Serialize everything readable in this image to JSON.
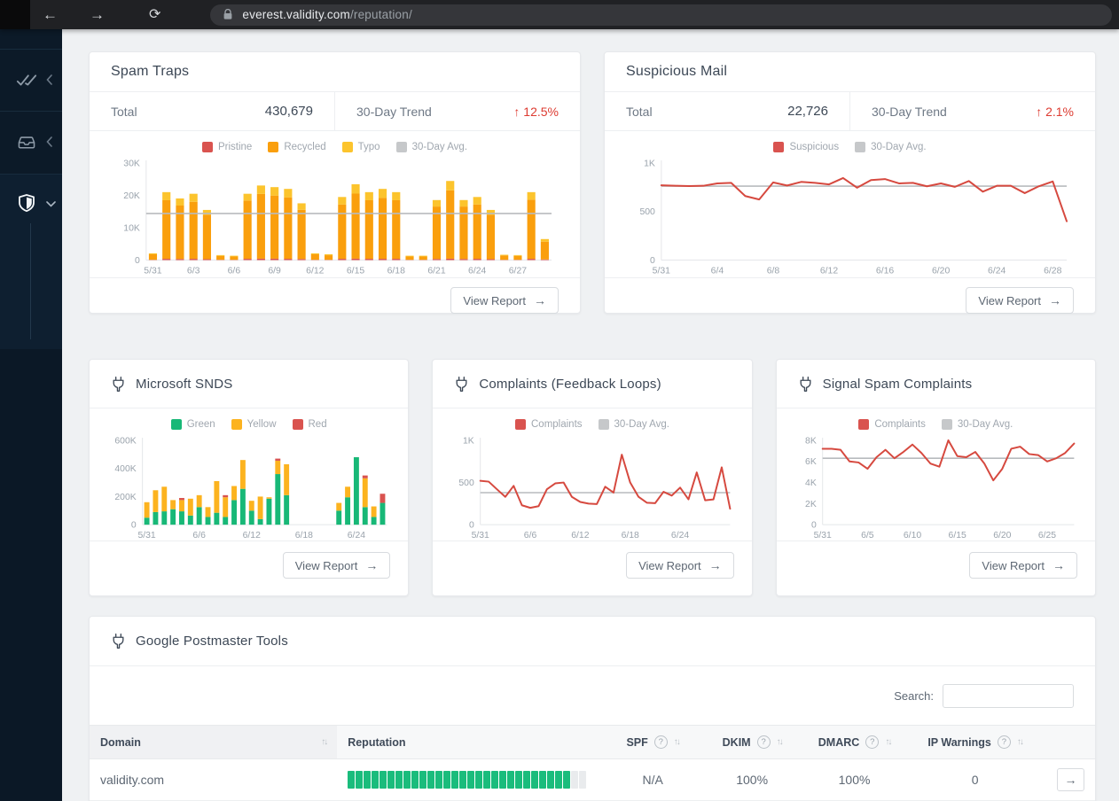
{
  "browser": {
    "url_host": "everest.validity.com",
    "url_path": "/reputation/"
  },
  "cards": {
    "spam_traps": {
      "title": "Spam Traps",
      "total_label": "Total",
      "total_value": "430,679",
      "trend_label": "30-Day Trend",
      "trend_arrow": "↑",
      "trend_value": "12.5%",
      "view_report": "View Report",
      "view_report_arrow": "→"
    },
    "suspicious_mail": {
      "title": "Suspicious Mail",
      "total_label": "Total",
      "total_value": "22,726",
      "trend_label": "30-Day Trend",
      "trend_arrow": "↑",
      "trend_value": "2.1%",
      "view_report": "View Report",
      "view_report_arrow": "→"
    },
    "msft_snds": {
      "title": "Microsoft SNDS",
      "view_report": "View Report",
      "view_report_arrow": "→"
    },
    "complaints_fbl": {
      "title": "Complaints (Feedback Loops)",
      "view_report": "View Report",
      "view_report_arrow": "→"
    },
    "signal_spam": {
      "title": "Signal Spam Complaints",
      "view_report": "View Report",
      "view_report_arrow": "→"
    },
    "google_postmaster": {
      "title": "Google Postmaster Tools",
      "search_label": "Search:",
      "search_value": "",
      "columns": [
        "Domain",
        "Reputation",
        "SPF",
        "DKIM",
        "DMARC",
        "IP Warnings"
      ],
      "rows": [
        {
          "domain": "validity.com",
          "reputation_segments": 30,
          "reputation_filled": 28,
          "spf": "N/A",
          "dkim": "100%",
          "dmarc": "100%",
          "ip_warnings": "0",
          "row_arrow": "→"
        }
      ]
    }
  },
  "colors": {
    "red": "#d9534f",
    "line_red": "#d6493f",
    "orange": "#fa9f0d",
    "yellow": "#fcc42d",
    "green": "#18b877",
    "avg_gray": "#b8bbbe",
    "trend_red": "#dd3b31",
    "table_green": "#1abc7c"
  },
  "chart_data": [
    {
      "id": "spam_traps",
      "type": "bar",
      "title": "Spam Traps",
      "categories": [
        "5/31",
        "6/1",
        "6/2",
        "6/3",
        "6/4",
        "6/5",
        "6/6",
        "6/7",
        "6/8",
        "6/9",
        "6/10",
        "6/11",
        "6/12",
        "6/13",
        "6/14",
        "6/15",
        "6/16",
        "6/17",
        "6/18",
        "6/19",
        "6/20",
        "6/21",
        "6/22",
        "6/23",
        "6/24",
        "6/25",
        "6/26",
        "6/27",
        "6/28",
        "6/29"
      ],
      "series": [
        {
          "name": "Pristine",
          "color": "#d9534f",
          "values": [
            100,
            400,
            350,
            400,
            300,
            100,
            100,
            400,
            450,
            450,
            400,
            350,
            100,
            100,
            400,
            450,
            400,
            400,
            400,
            100,
            100,
            350,
            450,
            350,
            400,
            300,
            100,
            100,
            400,
            200
          ]
        },
        {
          "name": "Recycled",
          "color": "#fa9f0d",
          "values": [
            1700,
            18100,
            16500,
            17600,
            13700,
            1200,
            1000,
            18000,
            20000,
            19500,
            19000,
            15200,
            1700,
            1400,
            16800,
            20100,
            18100,
            18800,
            18100,
            1000,
            1000,
            16200,
            21100,
            16200,
            16800,
            13700,
            1300,
            1200,
            18300,
            5500
          ]
        },
        {
          "name": "Typo",
          "color": "#fcc42d",
          "values": [
            300,
            2500,
            2200,
            2500,
            1500,
            250,
            250,
            2100,
            2600,
            2600,
            2600,
            2000,
            300,
            300,
            2300,
            2900,
            2500,
            2800,
            2500,
            250,
            250,
            2000,
            2900,
            2000,
            2300,
            1500,
            250,
            250,
            2300,
            800
          ]
        }
      ],
      "avg": {
        "label": "30-Day Avg.",
        "value": 14400,
        "color": "#b8bbbe"
      },
      "legend": [
        {
          "label": "Pristine",
          "color": "#d9534f"
        },
        {
          "label": "Recycled",
          "color": "#fa9f0d"
        },
        {
          "label": "Typo",
          "color": "#fcc42d"
        },
        {
          "label": "30-Day Avg.",
          "color": "#c6c8ca"
        }
      ],
      "ymax": 30000,
      "yticks": [
        {
          "v": 0,
          "label": "0"
        },
        {
          "v": 10000,
          "label": "10K"
        },
        {
          "v": 20000,
          "label": "20K"
        },
        {
          "v": 30000,
          "label": "30K"
        }
      ],
      "xticks": [
        {
          "i": 0,
          "label": "5/31"
        },
        {
          "i": 3,
          "label": "6/3"
        },
        {
          "i": 6,
          "label": "6/6"
        },
        {
          "i": 9,
          "label": "6/9"
        },
        {
          "i": 12,
          "label": "6/12"
        },
        {
          "i": 15,
          "label": "6/15"
        },
        {
          "i": 18,
          "label": "6/18"
        },
        {
          "i": 21,
          "label": "6/21"
        },
        {
          "i": 24,
          "label": "6/24"
        },
        {
          "i": 27,
          "label": "6/27"
        }
      ]
    },
    {
      "id": "suspicious_mail",
      "type": "line",
      "title": "Suspicious Mail",
      "categories": [
        "5/31",
        "6/1",
        "6/2",
        "6/3",
        "6/4",
        "6/5",
        "6/6",
        "6/7",
        "6/8",
        "6/9",
        "6/10",
        "6/11",
        "6/12",
        "6/13",
        "6/14",
        "6/15",
        "6/16",
        "6/17",
        "6/18",
        "6/19",
        "6/20",
        "6/21",
        "6/22",
        "6/23",
        "6/24",
        "6/25",
        "6/26",
        "6/27",
        "6/28",
        "6/29"
      ],
      "series": [
        {
          "name": "Suspicious",
          "color": "#d6493f",
          "values": [
            770,
            765,
            763,
            765,
            790,
            795,
            660,
            625,
            800,
            768,
            805,
            795,
            780,
            845,
            745,
            825,
            835,
            790,
            795,
            760,
            790,
            755,
            815,
            705,
            765,
            765,
            690,
            760,
            810,
            400
          ]
        }
      ],
      "avg": {
        "label": "30-Day Avg.",
        "value": 762,
        "color": "#b8bbbe"
      },
      "legend": [
        {
          "label": "Suspicious",
          "color": "#d9534f"
        },
        {
          "label": "30-Day Avg.",
          "color": "#c6c8ca"
        }
      ],
      "ymax": 1000,
      "yticks": [
        {
          "v": 0,
          "label": "0"
        },
        {
          "v": 500,
          "label": "500"
        },
        {
          "v": 1000,
          "label": "1K"
        }
      ],
      "xticks": [
        {
          "i": 0,
          "label": "5/31"
        },
        {
          "i": 4,
          "label": "6/4"
        },
        {
          "i": 8,
          "label": "6/8"
        },
        {
          "i": 12,
          "label": "6/12"
        },
        {
          "i": 16,
          "label": "6/16"
        },
        {
          "i": 20,
          "label": "6/20"
        },
        {
          "i": 24,
          "label": "6/24"
        },
        {
          "i": 28,
          "label": "6/28"
        }
      ]
    },
    {
      "id": "msft_snds",
      "type": "bar",
      "title": "Microsoft SNDS",
      "categories": [
        "5/31",
        "6/1",
        "6/2",
        "6/3",
        "6/4",
        "6/5",
        "6/6",
        "6/7",
        "6/8",
        "6/9",
        "6/10",
        "6/11",
        "6/12",
        "6/13",
        "6/14",
        "6/15",
        "6/16",
        "6/17",
        "6/18",
        "6/19",
        "6/20",
        "6/21",
        "6/22",
        "6/23",
        "6/24",
        "6/25",
        "6/26",
        "6/27"
      ],
      "unit": "K",
      "series": [
        {
          "name": "Green",
          "color": "#18b877",
          "values": [
            50,
            90,
            95,
            110,
            95,
            65,
            125,
            55,
            85,
            55,
            175,
            255,
            100,
            40,
            185,
            360,
            210,
            0,
            0,
            0,
            0,
            0,
            100,
            195,
            480,
            125,
            55,
            155
          ]
        },
        {
          "name": "Yellow",
          "color": "#fcb31f",
          "values": [
            110,
            155,
            175,
            65,
            80,
            120,
            85,
            70,
            225,
            140,
            100,
            205,
            70,
            160,
            10,
            95,
            220,
            0,
            0,
            0,
            0,
            0,
            55,
            75,
            0,
            205,
            75,
            0
          ]
        },
        {
          "name": "Red",
          "color": "#d9534f",
          "values": [
            0,
            0,
            0,
            0,
            15,
            0,
            0,
            0,
            0,
            15,
            0,
            0,
            0,
            0,
            0,
            15,
            0,
            0,
            0,
            0,
            0,
            0,
            0,
            0,
            0,
            20,
            0,
            65
          ]
        }
      ],
      "legend": [
        {
          "label": "Green",
          "color": "#18b877"
        },
        {
          "label": "Yellow",
          "color": "#fcb31f"
        },
        {
          "label": "Red",
          "color": "#d9534f"
        }
      ],
      "ymax": 600,
      "yticks": [
        {
          "v": 0,
          "label": "0"
        },
        {
          "v": 200,
          "label": "200K"
        },
        {
          "v": 400,
          "label": "400K"
        },
        {
          "v": 600,
          "label": "600K"
        }
      ],
      "xticks": [
        {
          "i": 0,
          "label": "5/31"
        },
        {
          "i": 6,
          "label": "6/6"
        },
        {
          "i": 12,
          "label": "6/12"
        },
        {
          "i": 18,
          "label": "6/18"
        },
        {
          "i": 24,
          "label": "6/24"
        }
      ]
    },
    {
      "id": "complaints_fbl",
      "type": "line",
      "title": "Complaints (Feedback Loops)",
      "categories": [
        "5/31",
        "6/1",
        "6/2",
        "6/3",
        "6/4",
        "6/5",
        "6/6",
        "6/7",
        "6/8",
        "6/9",
        "6/10",
        "6/11",
        "6/12",
        "6/13",
        "6/14",
        "6/15",
        "6/16",
        "6/17",
        "6/18",
        "6/19",
        "6/20",
        "6/21",
        "6/22",
        "6/23",
        "6/24",
        "6/25",
        "6/26",
        "6/27",
        "6/28",
        "6/29",
        "6/30"
      ],
      "series": [
        {
          "name": "Complaints",
          "color": "#d6493f",
          "values": [
            520,
            510,
            420,
            330,
            460,
            230,
            200,
            220,
            420,
            490,
            500,
            330,
            270,
            250,
            245,
            450,
            380,
            830,
            500,
            330,
            260,
            255,
            390,
            345,
            440,
            300,
            620,
            290,
            300,
            680,
            190
          ]
        }
      ],
      "avg": {
        "label": "30-Day Avg.",
        "value": 380,
        "color": "#b8bbbe"
      },
      "legend": [
        {
          "label": "Complaints",
          "color": "#d9534f"
        },
        {
          "label": "30-Day Avg.",
          "color": "#c6c8ca"
        }
      ],
      "ymax": 1000,
      "yticks": [
        {
          "v": 0,
          "label": "0"
        },
        {
          "v": 500,
          "label": "500"
        },
        {
          "v": 1000,
          "label": "1K"
        }
      ],
      "xticks": [
        {
          "i": 0,
          "label": "5/31"
        },
        {
          "i": 6,
          "label": "6/6"
        },
        {
          "i": 12,
          "label": "6/12"
        },
        {
          "i": 18,
          "label": "6/18"
        },
        {
          "i": 24,
          "label": "6/24"
        }
      ]
    },
    {
      "id": "signal_spam",
      "type": "line",
      "title": "Signal Spam Complaints",
      "categories": [
        "5/31",
        "6/1",
        "6/2",
        "6/3",
        "6/4",
        "6/5",
        "6/6",
        "6/7",
        "6/8",
        "6/9",
        "6/10",
        "6/11",
        "6/12",
        "6/13",
        "6/14",
        "6/15",
        "6/16",
        "6/17",
        "6/18",
        "6/19",
        "6/20",
        "6/21",
        "6/22",
        "6/23",
        "6/24",
        "6/25",
        "6/26",
        "6/27",
        "6/28"
      ],
      "unit": "K",
      "series": [
        {
          "name": "Complaints",
          "color": "#d6493f",
          "values": [
            7.2,
            7.2,
            7.1,
            6.0,
            5.9,
            5.3,
            6.4,
            7.1,
            6.3,
            6.9,
            7.6,
            6.8,
            5.8,
            5.5,
            8.0,
            6.5,
            6.4,
            6.9,
            5.8,
            4.2,
            5.3,
            7.2,
            7.4,
            6.7,
            6.6,
            6.0,
            6.3,
            6.8,
            7.7
          ]
        }
      ],
      "avg": {
        "label": "30-Day Avg.",
        "value": 6.3,
        "color": "#b8bbbe"
      },
      "legend": [
        {
          "label": "Complaints",
          "color": "#d9534f"
        },
        {
          "label": "30-Day Avg.",
          "color": "#c6c8ca"
        }
      ],
      "ymax": 8,
      "yticks": [
        {
          "v": 0,
          "label": "0"
        },
        {
          "v": 2,
          "label": "2K"
        },
        {
          "v": 4,
          "label": "4K"
        },
        {
          "v": 6,
          "label": "6K"
        },
        {
          "v": 8,
          "label": "8K"
        }
      ],
      "xticks": [
        {
          "i": 0,
          "label": "5/31"
        },
        {
          "i": 5,
          "label": "6/5"
        },
        {
          "i": 10,
          "label": "6/10"
        },
        {
          "i": 15,
          "label": "6/15"
        },
        {
          "i": 20,
          "label": "6/20"
        },
        {
          "i": 25,
          "label": "6/25"
        }
      ]
    }
  ]
}
